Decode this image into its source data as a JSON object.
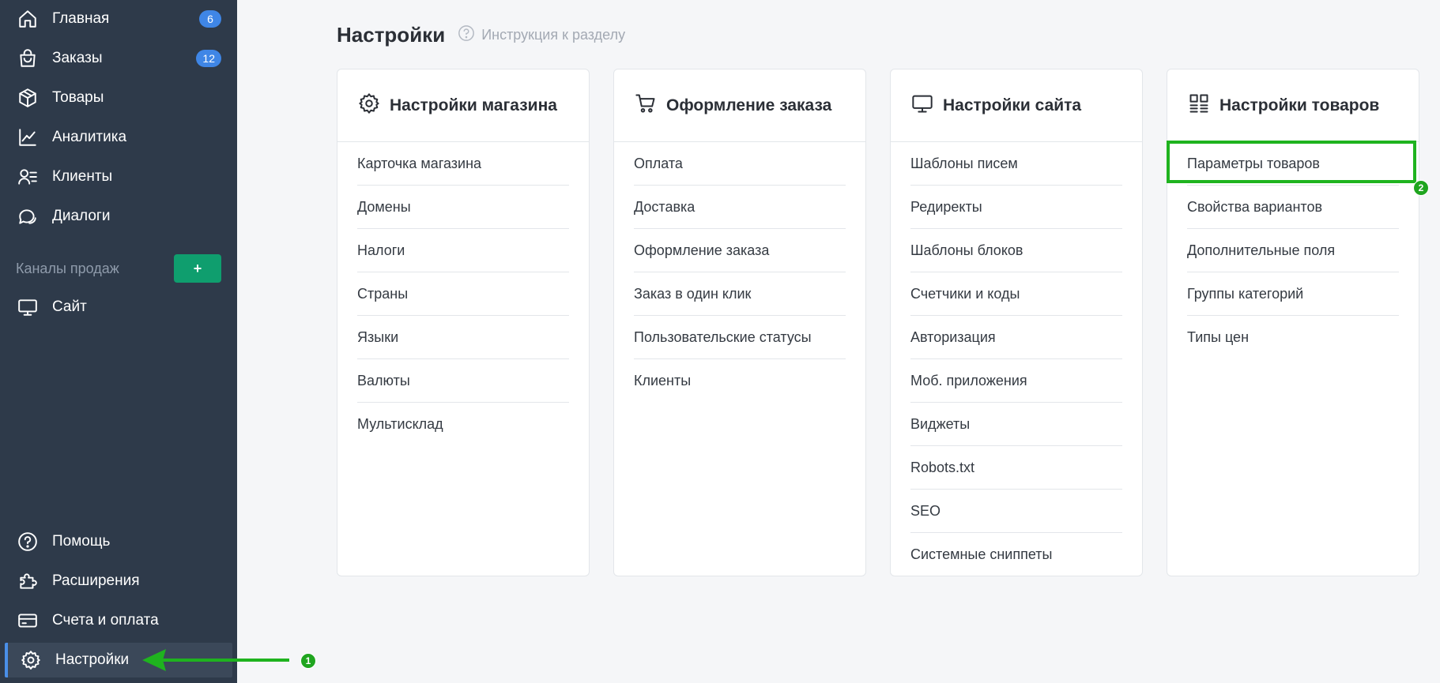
{
  "sidebar": {
    "nav": [
      {
        "label": "Главная",
        "icon": "home-icon",
        "badge": "6"
      },
      {
        "label": "Заказы",
        "icon": "shopping-bag-icon",
        "badge": "12"
      },
      {
        "label": "Товары",
        "icon": "box-icon"
      },
      {
        "label": "Аналитика",
        "icon": "chart-line-icon"
      },
      {
        "label": "Клиенты",
        "icon": "users-list-icon"
      },
      {
        "label": "Диалоги",
        "icon": "chat-icon"
      }
    ],
    "channels_label": "Каналы продаж",
    "add_channel_label": "+",
    "channels": [
      {
        "label": "Сайт",
        "icon": "monitor-icon"
      }
    ],
    "bottom": [
      {
        "label": "Помощь",
        "icon": "help-icon"
      },
      {
        "label": "Расширения",
        "icon": "puzzle-icon"
      },
      {
        "label": "Счета и оплата",
        "icon": "credit-card-icon"
      },
      {
        "label": "Настройки",
        "icon": "gear-icon",
        "active": true
      }
    ]
  },
  "header": {
    "title": "Настройки",
    "help_link": "Инструкция к разделу"
  },
  "cards": [
    {
      "title": "Настройки магазина",
      "icon": "gear-icon",
      "items": [
        "Карточка магазина",
        "Домены",
        "Налоги",
        "Страны",
        "Языки",
        "Валюты",
        "Мультисклад"
      ]
    },
    {
      "title": "Оформление заказа",
      "icon": "cart-icon",
      "items": [
        "Оплата",
        "Доставка",
        "Оформление заказа",
        "Заказ в один клик",
        "Пользовательские статусы",
        "Клиенты"
      ]
    },
    {
      "title": "Настройки сайта",
      "icon": "monitor-icon",
      "items": [
        "Шаблоны писем",
        "Редиректы",
        "Шаблоны блоков",
        "Счетчики и коды",
        "Авторизация",
        "Моб. приложения",
        "Виджеты",
        "Robots.txt",
        "SEO",
        "Системные сниппеты"
      ]
    },
    {
      "title": "Настройки товаров",
      "icon": "grid-list-icon",
      "items": [
        "Параметры товаров",
        "Свойства вариантов",
        "Дополнительные поля",
        "Группы категорий",
        "Типы цен"
      ]
    }
  ],
  "annotations": {
    "step1": "1",
    "step2": "2",
    "color": "#1fb31f"
  },
  "colors": {
    "sidebar_bg": "#2e3a4a",
    "badge": "#3f86e6",
    "add_button": "#0f9e6e",
    "page_bg": "#f5f6f8"
  }
}
